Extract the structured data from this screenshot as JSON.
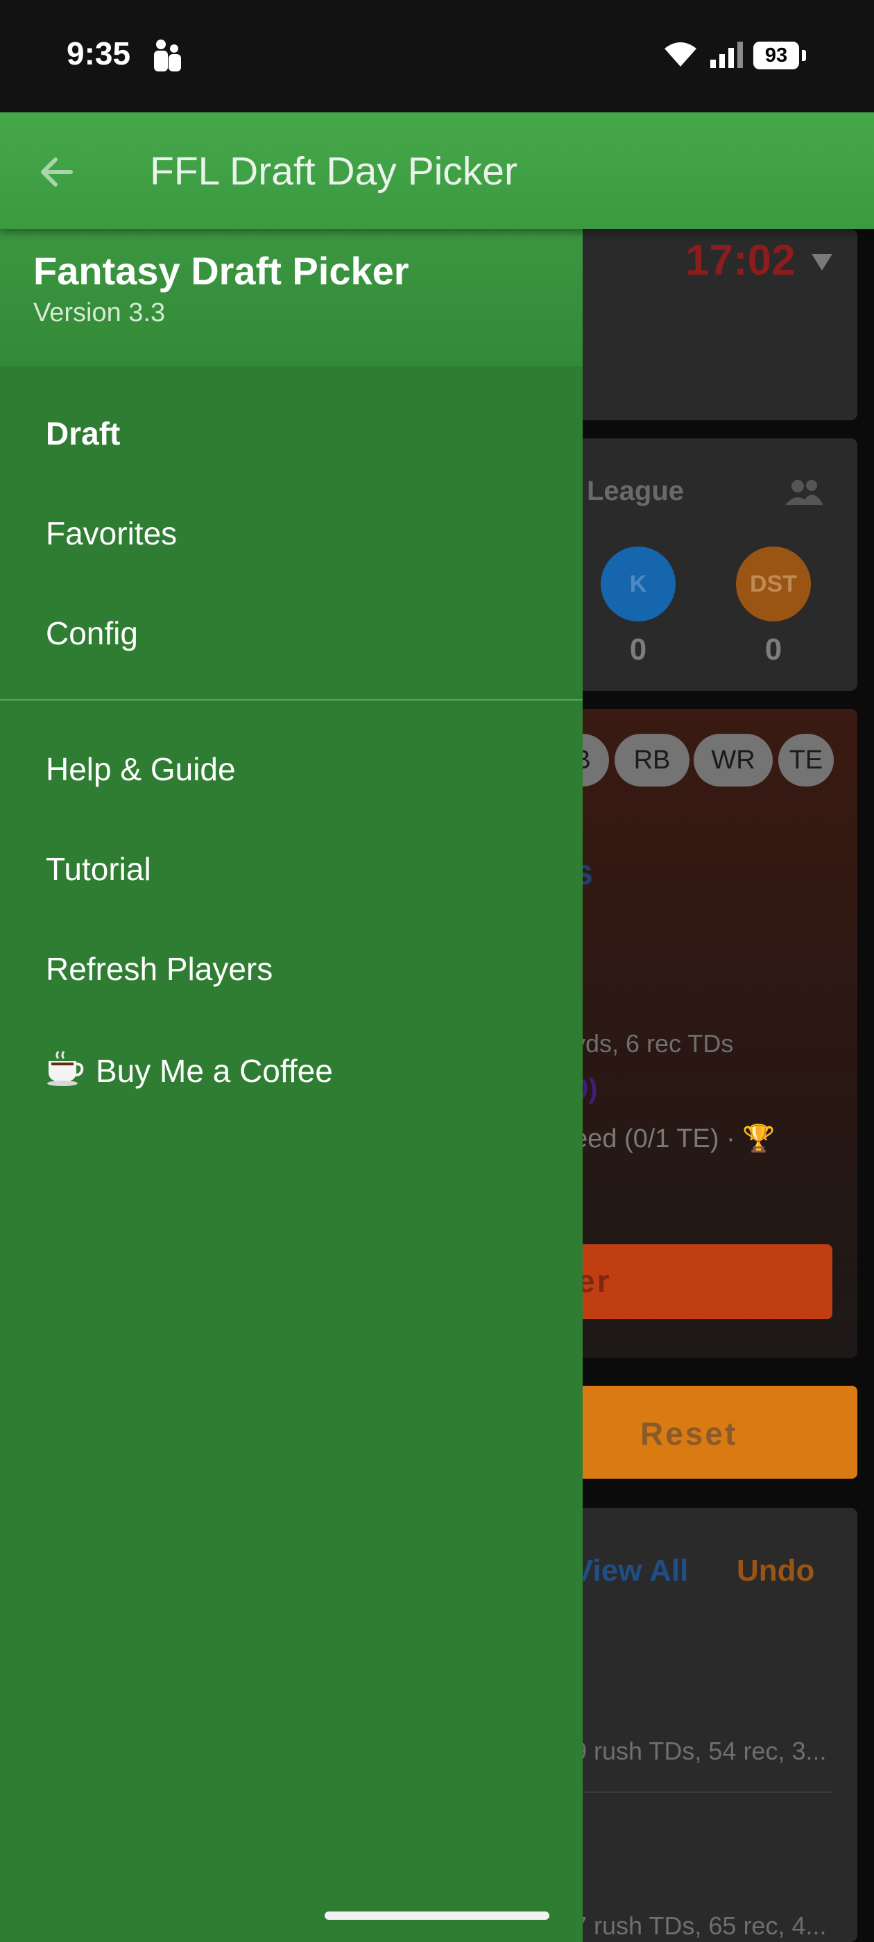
{
  "status_bar": {
    "time": "9:35",
    "battery": "93"
  },
  "app_bar": {
    "title": "FFL Draft Day Picker"
  },
  "drawer": {
    "title": "Fantasy Draft Picker",
    "version": "Version 3.3",
    "primary_items": [
      {
        "label": "Draft",
        "active": true
      },
      {
        "label": "Favorites"
      },
      {
        "label": "Config"
      }
    ],
    "secondary_items": [
      {
        "label": "Help & Guide"
      },
      {
        "label": "Tutorial"
      },
      {
        "label": "Refresh Players"
      },
      {
        "label": "Buy Me a Coffee",
        "icon": "coffee-icon"
      }
    ]
  },
  "background": {
    "timer": "17:02",
    "league_label": "League",
    "positions": [
      {
        "label": "K",
        "count": "0",
        "color": "#1666ad"
      },
      {
        "label": "DST",
        "count": "0",
        "color": "#9a5514"
      }
    ],
    "chips": [
      "B",
      "RB",
      "WR",
      "TE"
    ],
    "partial_name": "s",
    "stat_line": "yds, 6 rec TDs",
    "score": "0)",
    "need_line": "eed (0/1 TE) · 🏆",
    "draft_button": "er",
    "reset_button": "Reset",
    "view_all": "View All",
    "undo": "Undo",
    "pick_line_1": "9 rush TDs, 54 rec, 3...",
    "pick_line_2": "7 rush TDs, 65 rec, 4..."
  },
  "colors": {
    "drawer": "#2f7d33",
    "app_bar": "#43a047",
    "draft_button": "#c13e12",
    "reset_button": "#d97a12"
  }
}
